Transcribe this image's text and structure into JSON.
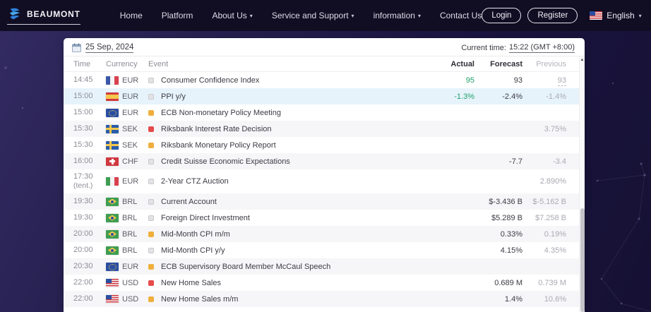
{
  "brand": {
    "name": "BEAUMONT"
  },
  "nav": {
    "items": [
      {
        "label": "Home",
        "dropdown": false
      },
      {
        "label": "Platform",
        "dropdown": false
      },
      {
        "label": "About Us",
        "dropdown": true
      },
      {
        "label": "Service and Support",
        "dropdown": true
      },
      {
        "label": "information",
        "dropdown": true
      },
      {
        "label": "Contact Us",
        "dropdown": false
      }
    ],
    "login_label": "Login",
    "register_label": "Register",
    "language": "English"
  },
  "calendar": {
    "date": "25 Sep, 2024",
    "current_time_label": "Current time:",
    "current_time_value": "15:22 (GMT +8:00)",
    "columns": {
      "time": "Time",
      "currency": "Currency",
      "event": "Event",
      "actual": "Actual",
      "forecast": "Forecast",
      "previous": "Previous"
    },
    "rows": [
      {
        "time": "14:45",
        "tent": "",
        "flag": "fr",
        "currency": "EUR",
        "importance": "low",
        "event": "Consumer Confidence Index",
        "actual": "95",
        "forecast": "93",
        "previous": "93",
        "previous_revised": true,
        "highlighted": false
      },
      {
        "time": "15:00",
        "tent": "",
        "flag": "es",
        "currency": "EUR",
        "importance": "low",
        "event": "PPI y/y",
        "actual": "-1.3%",
        "forecast": "-2.4%",
        "previous": "-1.4%",
        "previous_revised": false,
        "highlighted": true
      },
      {
        "time": "15:00",
        "tent": "",
        "flag": "eu",
        "currency": "EUR",
        "importance": "medium",
        "event": "ECB Non-monetary Policy Meeting",
        "actual": "",
        "forecast": "",
        "previous": "",
        "previous_revised": false,
        "highlighted": false
      },
      {
        "time": "15:30",
        "tent": "",
        "flag": "se",
        "currency": "SEK",
        "importance": "high",
        "event": "Riksbank Interest Rate Decision",
        "actual": "",
        "forecast": "",
        "previous": "3.75%",
        "previous_revised": false,
        "highlighted": false
      },
      {
        "time": "15:30",
        "tent": "",
        "flag": "se",
        "currency": "SEK",
        "importance": "medium",
        "event": "Riksbank Monetary Policy Report",
        "actual": "",
        "forecast": "",
        "previous": "",
        "previous_revised": false,
        "highlighted": false
      },
      {
        "time": "16:00",
        "tent": "",
        "flag": "ch",
        "currency": "CHF",
        "importance": "low",
        "event": "Credit Suisse Economic Expectations",
        "actual": "",
        "forecast": "-7.7",
        "previous": "-3.4",
        "previous_revised": false,
        "highlighted": false
      },
      {
        "time": "17:30",
        "tent": "(tent.)",
        "flag": "it",
        "currency": "EUR",
        "importance": "low",
        "event": "2-Year CTZ Auction",
        "actual": "",
        "forecast": "",
        "previous": "2.890%",
        "previous_revised": false,
        "highlighted": false
      },
      {
        "time": "19:30",
        "tent": "",
        "flag": "br",
        "currency": "BRL",
        "importance": "low",
        "event": "Current Account",
        "actual": "",
        "forecast": "$-3.436 B",
        "previous": "$-5.162 B",
        "previous_revised": false,
        "highlighted": false
      },
      {
        "time": "19:30",
        "tent": "",
        "flag": "br",
        "currency": "BRL",
        "importance": "low",
        "event": "Foreign Direct Investment",
        "actual": "",
        "forecast": "$5.289 B",
        "previous": "$7.258 B",
        "previous_revised": false,
        "highlighted": false
      },
      {
        "time": "20:00",
        "tent": "",
        "flag": "br",
        "currency": "BRL",
        "importance": "medium",
        "event": "Mid-Month CPI m/m",
        "actual": "",
        "forecast": "0.33%",
        "previous": "0.19%",
        "previous_revised": false,
        "highlighted": false
      },
      {
        "time": "20:00",
        "tent": "",
        "flag": "br",
        "currency": "BRL",
        "importance": "low",
        "event": "Mid-Month CPI y/y",
        "actual": "",
        "forecast": "4.15%",
        "previous": "4.35%",
        "previous_revised": false,
        "highlighted": false
      },
      {
        "time": "20:30",
        "tent": "",
        "flag": "eu",
        "currency": "EUR",
        "importance": "medium",
        "event": "ECB Supervisory Board Member McCaul Speech",
        "actual": "",
        "forecast": "",
        "previous": "",
        "previous_revised": false,
        "highlighted": false
      },
      {
        "time": "22:00",
        "tent": "",
        "flag": "us",
        "currency": "USD",
        "importance": "high",
        "event": "New Home Sales",
        "actual": "",
        "forecast": "0.689 M",
        "previous": "0.739 M",
        "previous_revised": false,
        "highlighted": false
      },
      {
        "time": "22:00",
        "tent": "",
        "flag": "us",
        "currency": "USD",
        "importance": "medium",
        "event": "New Home Sales m/m",
        "actual": "",
        "forecast": "1.4%",
        "previous": "10.6%",
        "previous_revised": false,
        "highlighted": false
      }
    ]
  },
  "colors": {
    "accent_green": "#1fa069",
    "importance_high": "#e54b4b",
    "importance_medium": "#efaf3d",
    "importance_low": "#e3e3e6",
    "row_highlight": "#e7f3fb",
    "nav_background": "#110d22"
  }
}
